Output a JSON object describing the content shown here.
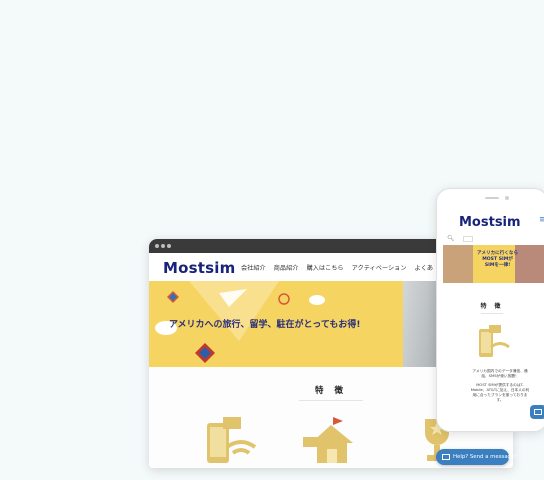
{
  "laptop": {
    "logo": "Mostsim",
    "nav": [
      "会社紹介",
      "商品紹介",
      "購入はこちら",
      "アクティベーション",
      "よくあ"
    ],
    "hero_text": "アメリカへの旅行、留学、駐在がとってもお得!",
    "features_title": "特 徴"
  },
  "phone": {
    "logo": "Mostsim",
    "menu_icon": "hamburger-icon",
    "hero_text_line1": "アメリカに行くなら",
    "hero_text_line2": "MOST SIMが",
    "hero_text_line3": "SIMを一律!",
    "features_title": "特 徴",
    "body_para1": "アメリカ国内でのデータ通信、通話、SMSが使い放題！",
    "body_para2": "MOST SIMが提供するのはT-Mobile、AT&Tに加え、日本人の利用に合ったプランを揃っております。"
  },
  "help_button": {
    "label": "Help? Send a message!",
    "icon": "envelope-icon"
  },
  "colors": {
    "brand": "#17247a",
    "hero": "#f6d462",
    "accent": "#3a7fc0",
    "icon_gold": "#e0c36b"
  }
}
